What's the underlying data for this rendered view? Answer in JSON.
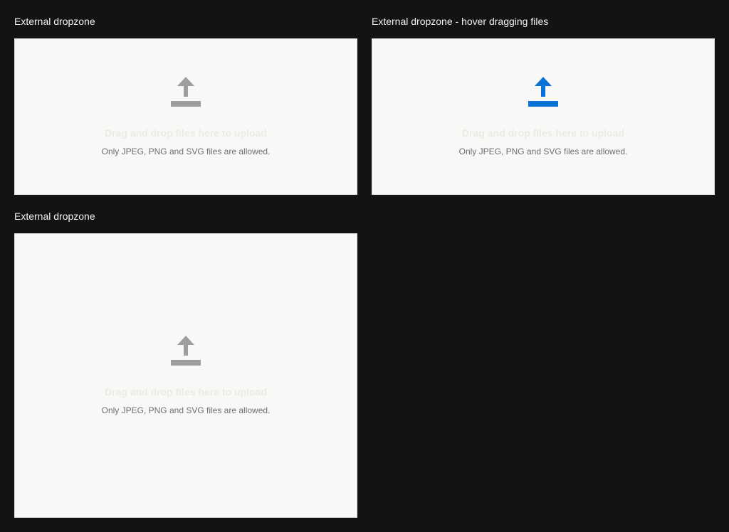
{
  "colors": {
    "background": "#131313",
    "dropzone_background": "#f9f8f6",
    "icon_default": "#9e9e9e",
    "icon_hover": "#0a72d7",
    "heading_text": "#f2f2f2",
    "secondary_text": "#6e6e6e"
  },
  "dropzones": [
    {
      "title": "External dropzone",
      "state": "default",
      "icon": "upload-icon",
      "primary_text": "Drag and drop files here to upload",
      "secondary_text": "Only JPEG, PNG and SVG files are allowed."
    },
    {
      "title": "External dropzone - hover dragging files",
      "state": "hover-dragging",
      "icon": "upload-icon",
      "primary_text": "Drag and drop files here to upload",
      "secondary_text": "Only JPEG, PNG and SVG files are allowed."
    },
    {
      "title": "External dropzone",
      "state": "default",
      "icon": "upload-icon",
      "primary_text": "Drag and drop files here to upload",
      "secondary_text": "Only JPEG, PNG and SVG files are allowed."
    }
  ]
}
